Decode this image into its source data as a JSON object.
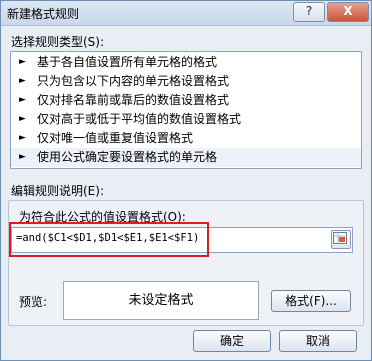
{
  "window": {
    "title": "新建格式规则",
    "help_label": "?",
    "close_label": "X"
  },
  "rule_type": {
    "label": "选择规则类型(S):",
    "items": [
      "基于各自值设置所有单元格的格式",
      "只为包含以下内容的单元格设置格式",
      "仅对排名靠前或靠后的数值设置格式",
      "仅对高于或低于平均值的数值设置格式",
      "仅对唯一值或重复值设置格式",
      "使用公式确定要设置格式的单元格"
    ],
    "selected_index": 5
  },
  "rule_description": {
    "label": "编辑规则说明(E):",
    "formula_label": "为符合此公式的值设置格式(O):",
    "formula_value": "=and($C1<$D1,$D1<$E1,$E1<$F1)",
    "range_button_icon": "range-select-icon",
    "preview_label": "预览:",
    "preview_text": "未设定格式",
    "format_button": "格式(F)..."
  },
  "footer": {
    "ok_label": "确定",
    "cancel_label": "取消"
  },
  "colors": {
    "highlight_border": "#d82020",
    "title_bar": "#c9d8ea",
    "close_button": "#c9533d"
  }
}
